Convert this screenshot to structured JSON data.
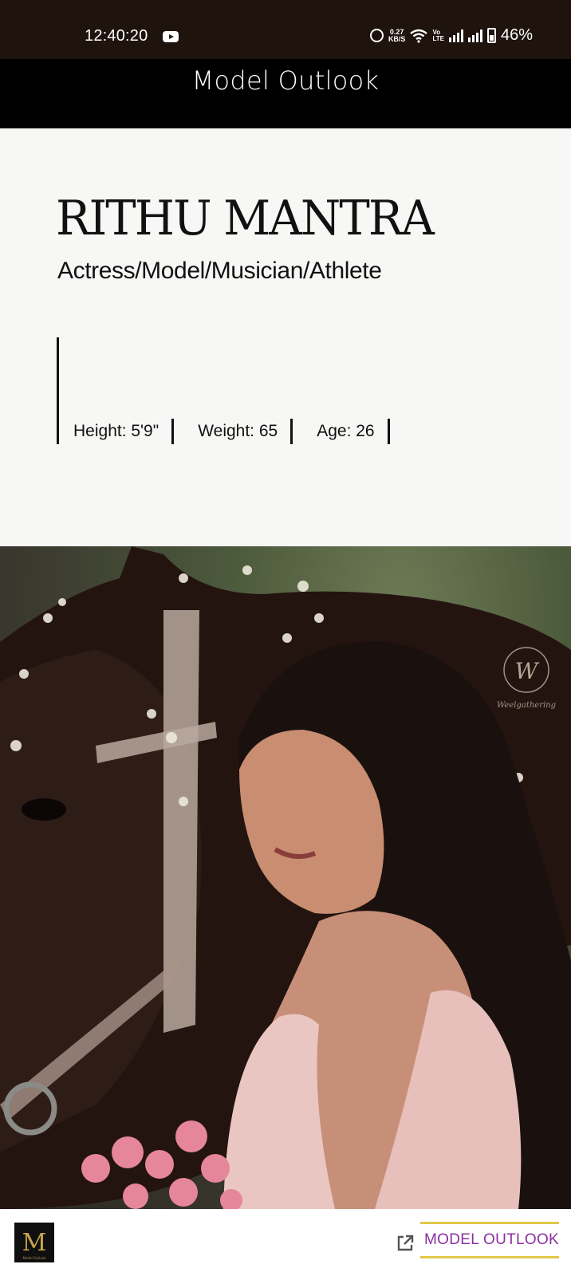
{
  "status_bar": {
    "time": "12:40:20",
    "net_speed_value": "0.27",
    "net_speed_unit": "KB/S",
    "volte_top": "Vo",
    "volte_bottom": "LTE",
    "battery": "46%",
    "icons": [
      "youtube-icon",
      "alarm-icon",
      "wifi-icon",
      "signal-icon",
      "battery-icon"
    ]
  },
  "header": {
    "title": "Model Outlook"
  },
  "profile": {
    "name": "RITHU MANTRA",
    "roles": "Actress/Model/Musician/Athlete",
    "stats": [
      {
        "label": "Height: 5'9\""
      },
      {
        "label": "Weight: 65"
      },
      {
        "label": "Age: 26"
      }
    ]
  },
  "photo": {
    "watermark": "Weelgathering"
  },
  "bottom_bar": {
    "logo_letter": "M",
    "logo_caption": "Model Outlook",
    "link_label": "MODEL OUTLOOK",
    "link_icon": "external-link-icon"
  },
  "colors": {
    "status_bar_bg": "#1e130d",
    "header_bg": "#000000",
    "profile_bg": "#f7f7f5",
    "link_text": "#8b2fa0",
    "link_border": "#e1c848",
    "logo_gold": "#c9a44b"
  }
}
